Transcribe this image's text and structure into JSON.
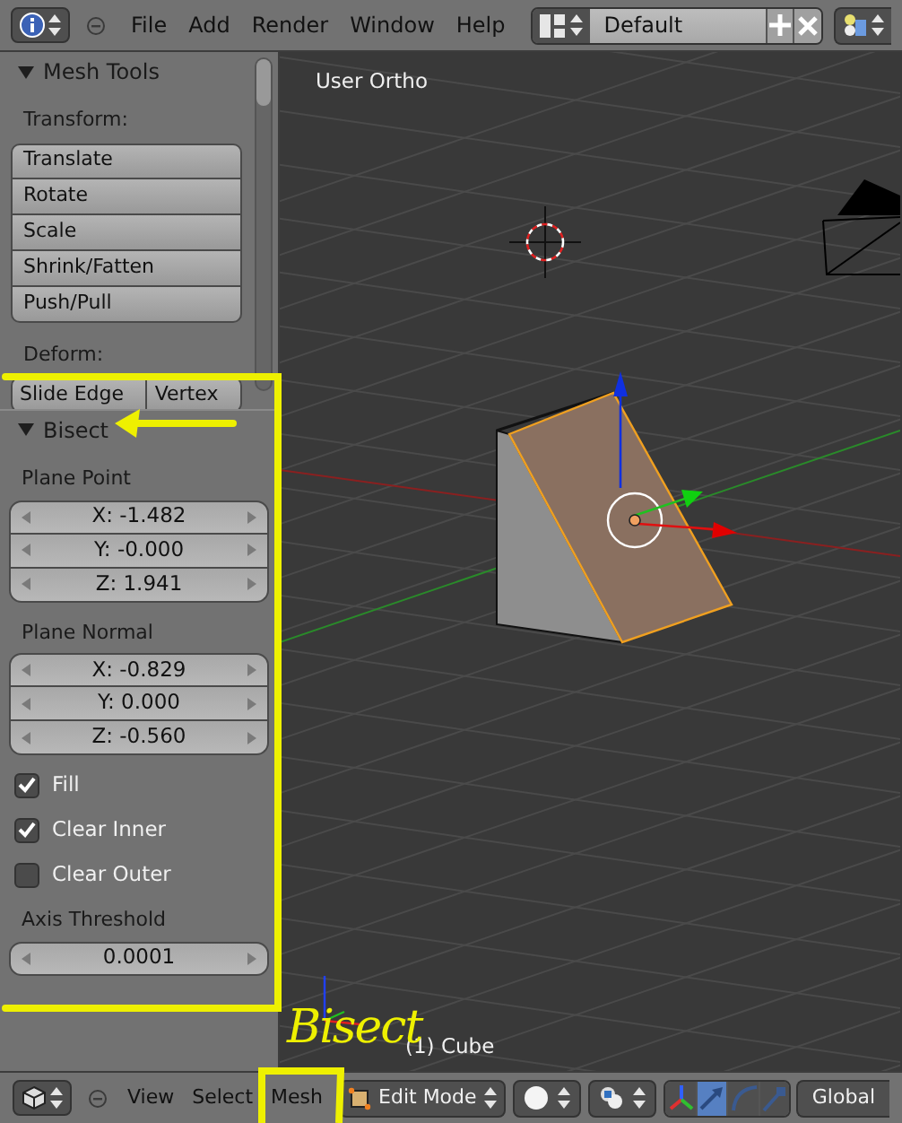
{
  "top_bar": {
    "menus": [
      "File",
      "Add",
      "Render",
      "Window",
      "Help"
    ],
    "layout_name": "Default"
  },
  "tool_shelf": {
    "title": "Mesh Tools",
    "expanded": true,
    "sections": [
      {
        "label": "Transform:",
        "kind": "stack",
        "buttons": [
          "Translate",
          "Rotate",
          "Scale",
          "Shrink/Fatten",
          "Push/Pull"
        ]
      },
      {
        "label": "Deform:",
        "kind": "row",
        "buttons": [
          "Slide Edge",
          "Vertex"
        ]
      }
    ]
  },
  "operator_panel": {
    "title": "Bisect",
    "expanded": true,
    "vectors": [
      {
        "label": "Plane Point",
        "fields": [
          "X: -1.482",
          "Y: -0.000",
          "Z: 1.941"
        ]
      },
      {
        "label": "Plane Normal",
        "fields": [
          "X: -0.829",
          "Y: 0.000",
          "Z: -0.560"
        ]
      }
    ],
    "options": [
      {
        "label": "Fill",
        "checked": true
      },
      {
        "label": "Clear Inner",
        "checked": true
      },
      {
        "label": "Clear Outer",
        "checked": false
      }
    ],
    "threshold": {
      "label": "Axis Threshold",
      "value": "0.0001"
    }
  },
  "viewport": {
    "view_name": "User Ortho",
    "object_name": "(1) Cube"
  },
  "annotation": {
    "text": "Bisect"
  },
  "bottom_bar": {
    "menus": [
      "View",
      "Select",
      "Mesh"
    ],
    "mode": "Edit Mode",
    "widgets": [
      {
        "kind": "axes",
        "selected": false
      },
      {
        "kind": "move",
        "selected": true
      },
      {
        "kind": "rotate",
        "selected": false
      },
      {
        "kind": "scale",
        "selected": false
      }
    ],
    "orientation": "Global"
  }
}
